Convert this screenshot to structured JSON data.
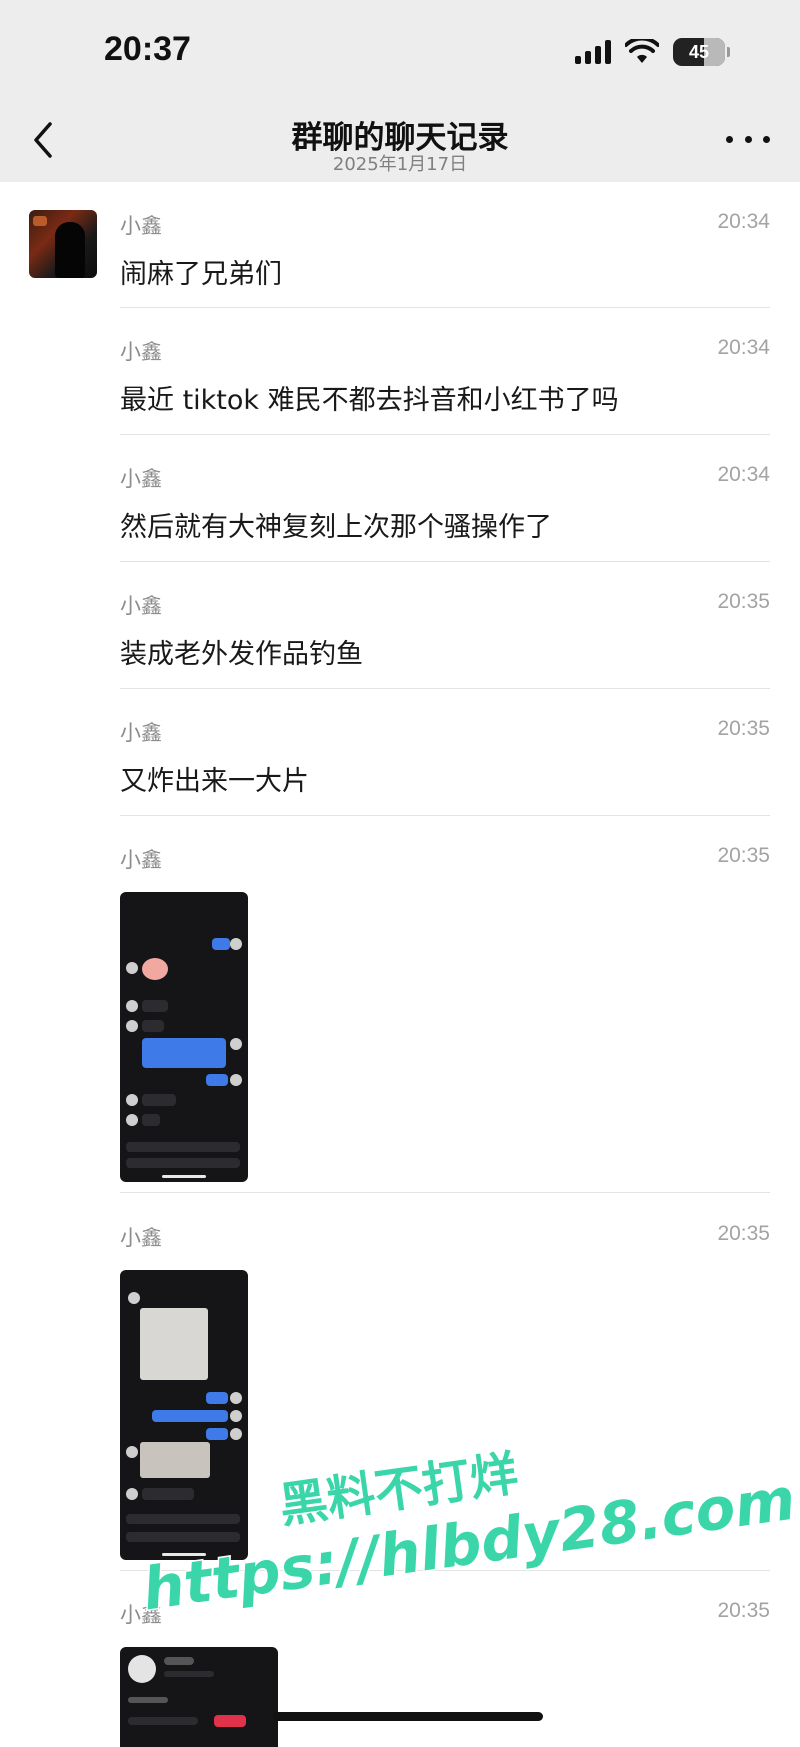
{
  "status_bar": {
    "time": "20:37",
    "battery": "45"
  },
  "nav": {
    "title": "群聊的聊天记录",
    "subtitle": "2025年1月17日"
  },
  "messages": [
    {
      "sender": "小鑫",
      "time": "20:34",
      "text": "闹麻了兄弟们"
    },
    {
      "sender": "小鑫",
      "time": "20:34",
      "text": "最近 tiktok 难民不都去抖音和小红书了吗"
    },
    {
      "sender": "小鑫",
      "time": "20:34",
      "text": "然后就有大神复刻上次那个骚操作了"
    },
    {
      "sender": "小鑫",
      "time": "20:35",
      "text": "装成老外发作品钓鱼"
    },
    {
      "sender": "小鑫",
      "time": "20:35",
      "text": "又炸出来一大片"
    },
    {
      "sender": "小鑫",
      "time": "20:35",
      "image": "screenshot-chat-1"
    },
    {
      "sender": "小鑫",
      "time": "20:35",
      "image": "screenshot-chat-2"
    },
    {
      "sender": "小鑫",
      "time": "20:35",
      "image": "screenshot-profile"
    }
  ],
  "watermark": {
    "line1": "黑料不打烊",
    "line2": "https://hlbdy28.com"
  },
  "colors": {
    "header_bg": "#ededed",
    "watermark": "#3ad6a9",
    "accent_blue": "#3f7be8"
  }
}
